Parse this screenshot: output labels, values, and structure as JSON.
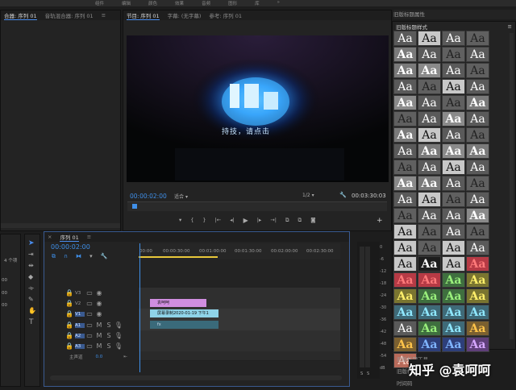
{
  "menu": [
    "组件",
    "编辑",
    "颜色",
    "效果",
    "音频",
    "图形",
    "库",
    "»"
  ],
  "left_panel": {
    "tabs": [
      "音轨混合器: 序列 01",
      "合器: 序列 01"
    ],
    "source_tab": "混合器: 序列 01",
    "audio_mixer_tab": "音轨混合器: 序列 01",
    "items_count": "4 个项",
    "left_rows": [
      "00",
      "00",
      "00"
    ]
  },
  "program": {
    "tab": "节目: 序列 01",
    "tab_caption": "字幕: (无字幕)",
    "tab_reference": "参考: 序列 01",
    "current_time": "00:00:02:00",
    "fit": "适合",
    "resolution": "1/2",
    "duration": "00:03:30:03",
    "overlay_text": "持技，请点击"
  },
  "timeline": {
    "tab": "序列 01",
    "current_time": "00:00:02:00",
    "ruler": [
      "00:00",
      "00:00:30:00",
      "00:01:00:00",
      "00:01:30:00",
      "00:02:00:00",
      "00:02:30:00"
    ],
    "video_tracks": [
      "V3",
      "V2",
      "V1"
    ],
    "audio_tracks": [
      "A1",
      "A2",
      "A3"
    ],
    "master": "主声道",
    "master_value": "0.0",
    "clips": {
      "title": "袁呵呵",
      "video": "屏幕录制2020-01-19 下午1",
      "audio": "fx"
    }
  },
  "meter": {
    "labels": [
      "0",
      "-6",
      "-12",
      "-18",
      "-24",
      "-30",
      "-36",
      "-42",
      "-48",
      "-54",
      "dB"
    ],
    "solo": [
      "S",
      "S"
    ]
  },
  "styles": {
    "panel_title": "旧版标题属性",
    "section_title": "旧版标题样式",
    "sample": "Aa",
    "footer_tools": "旧版标题工具",
    "footer_actions": "旧版标题动作",
    "footer_timecode": "时间码"
  },
  "watermark": "知乎 @袁呵呵",
  "colors": {
    "accent": "#4a8ef0",
    "timecode": "#3f8fe8",
    "title_clip": "#d08ee0",
    "video_clip": "#8fd3e8",
    "audio_clip": "#3a6a7a"
  }
}
